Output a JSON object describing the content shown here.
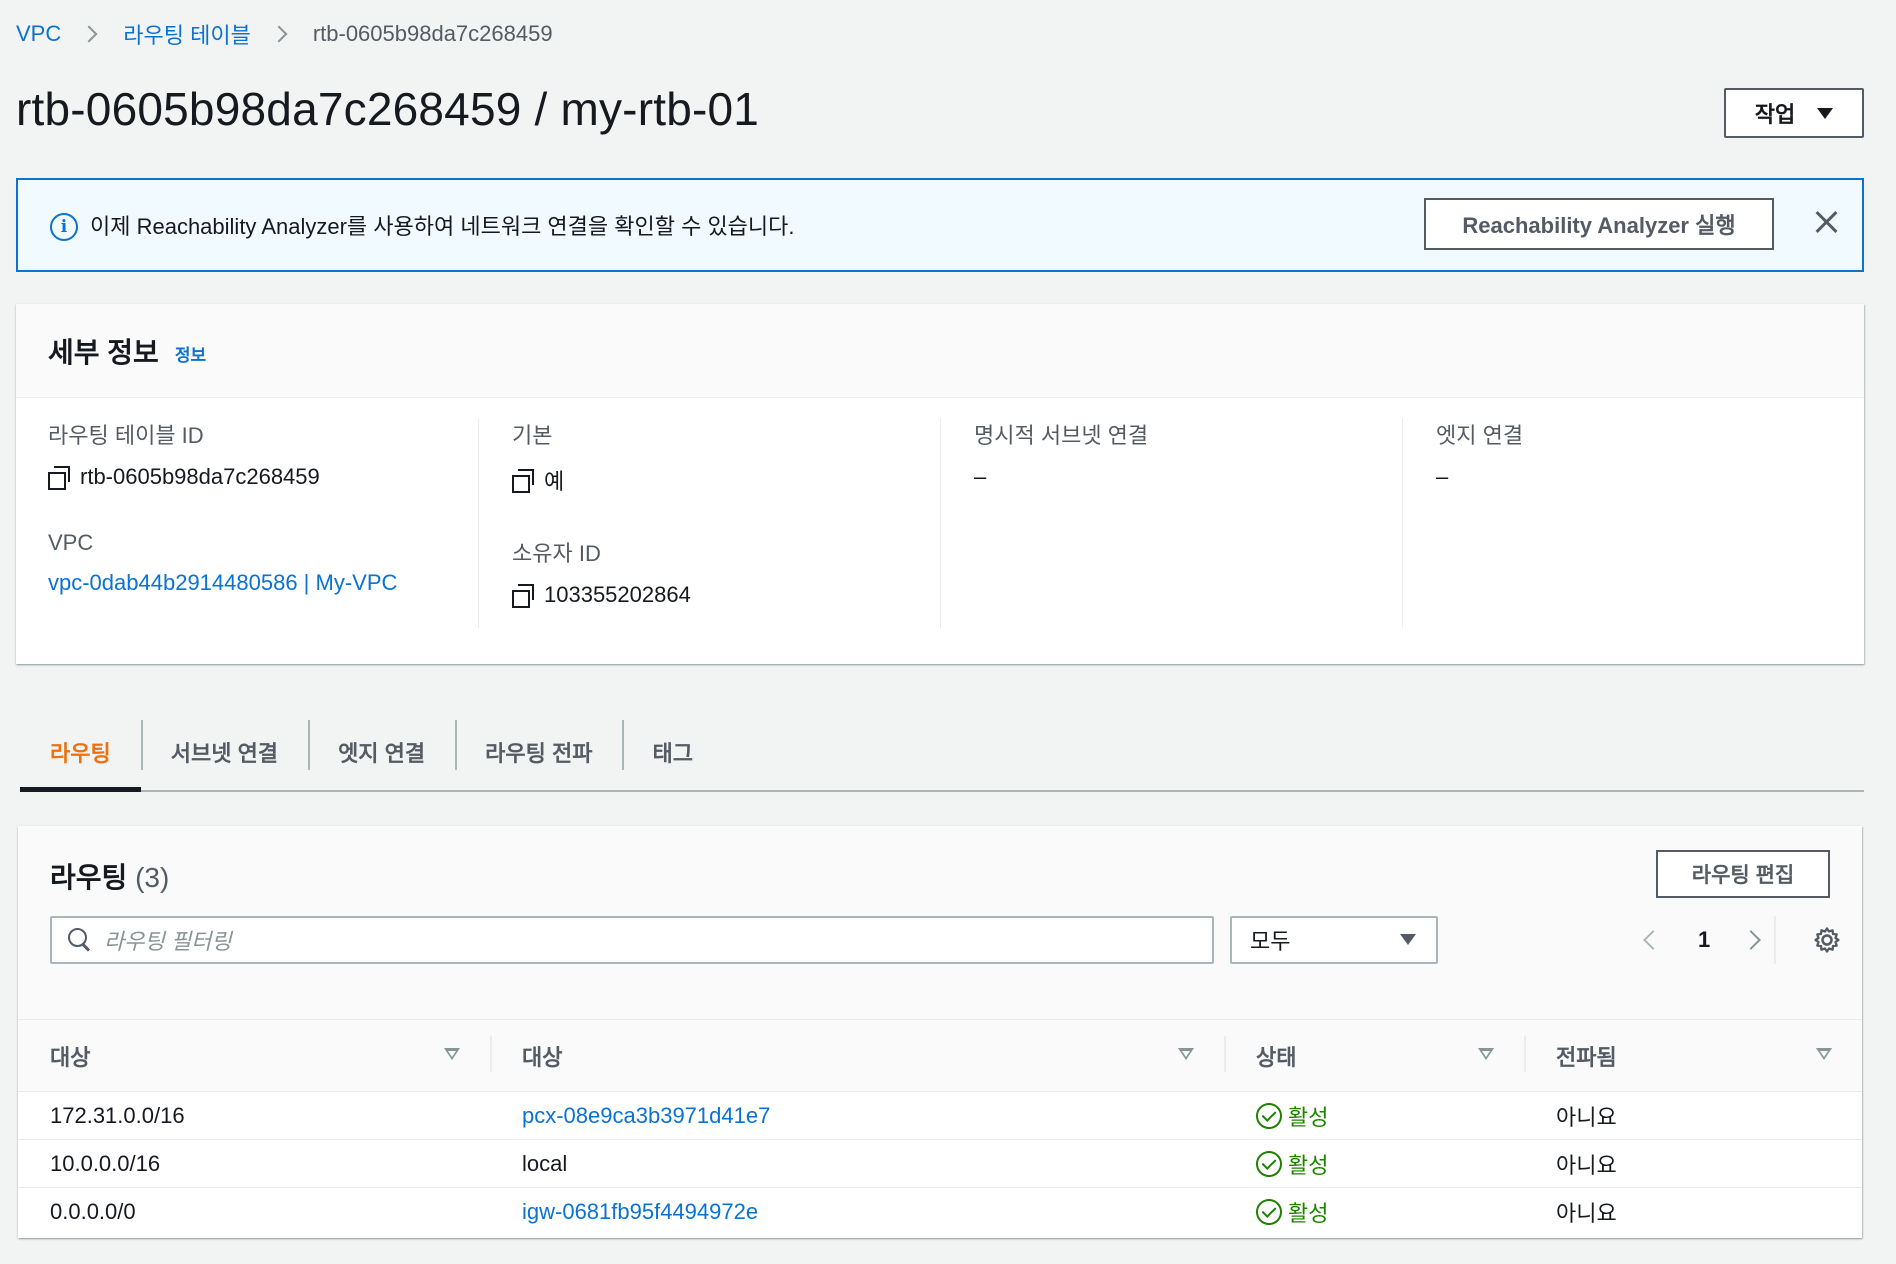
{
  "breadcrumb": {
    "items": [
      "VPC",
      "라우팅 테이블",
      "rtb-0605b98da7c268459"
    ]
  },
  "page": {
    "title": "rtb-0605b98da7c268459 / my-rtb-01",
    "actions_label": "작업"
  },
  "banner": {
    "text": "이제 Reachability Analyzer를 사용하여 네트워크 연결을 확인할 수 있습니다.",
    "button_label": "Reachability Analyzer 실행"
  },
  "details": {
    "title": "세부 정보",
    "info_link": "정보",
    "fields": {
      "route_table_id_label": "라우팅 테이블 ID",
      "route_table_id_value": "rtb-0605b98da7c268459",
      "vpc_label": "VPC",
      "vpc_value": "vpc-0dab44b2914480586 | My-VPC",
      "main_label": "기본",
      "main_value": "예",
      "owner_label": "소유자 ID",
      "owner_value": "103355202864",
      "explicit_subnet_label": "명시적 서브넷 연결",
      "explicit_subnet_value": "–",
      "edge_label": "엣지 연결",
      "edge_value": "–"
    }
  },
  "tabs": [
    {
      "label": "라우팅",
      "active": true
    },
    {
      "label": "서브넷 연결",
      "active": false
    },
    {
      "label": "엣지 연결",
      "active": false
    },
    {
      "label": "라우팅 전파",
      "active": false
    },
    {
      "label": "태그",
      "active": false
    }
  ],
  "routes": {
    "title": "라우팅",
    "count": "(3)",
    "edit_label": "라우팅 편집",
    "filter_placeholder": "라우팅 필터링",
    "select_value": "모두",
    "page_number": "1",
    "columns": [
      "대상",
      "대상",
      "상태",
      "전파됨"
    ],
    "rows": [
      {
        "destination": "172.31.0.0/16",
        "target": "pcx-08e9ca3b3971d41e7",
        "target_link": true,
        "status": "활성",
        "propagated": "아니요"
      },
      {
        "destination": "10.0.0.0/16",
        "target": "local",
        "target_link": false,
        "status": "활성",
        "propagated": "아니요"
      },
      {
        "destination": "0.0.0.0/0",
        "target": "igw-0681fb95f4494972e",
        "target_link": true,
        "status": "활성",
        "propagated": "아니요"
      }
    ]
  },
  "colors": {
    "link": "#0972d3",
    "active_tab": "#ec7211",
    "status_active": "#1d8102",
    "banner_bg": "#f1faff"
  },
  "icons": [
    "chevron-right-icon",
    "caret-down-icon",
    "info-icon",
    "close-icon",
    "copy-icon",
    "search-icon",
    "chevron-left-icon",
    "gear-icon",
    "sort-icon",
    "status-success-icon"
  ]
}
